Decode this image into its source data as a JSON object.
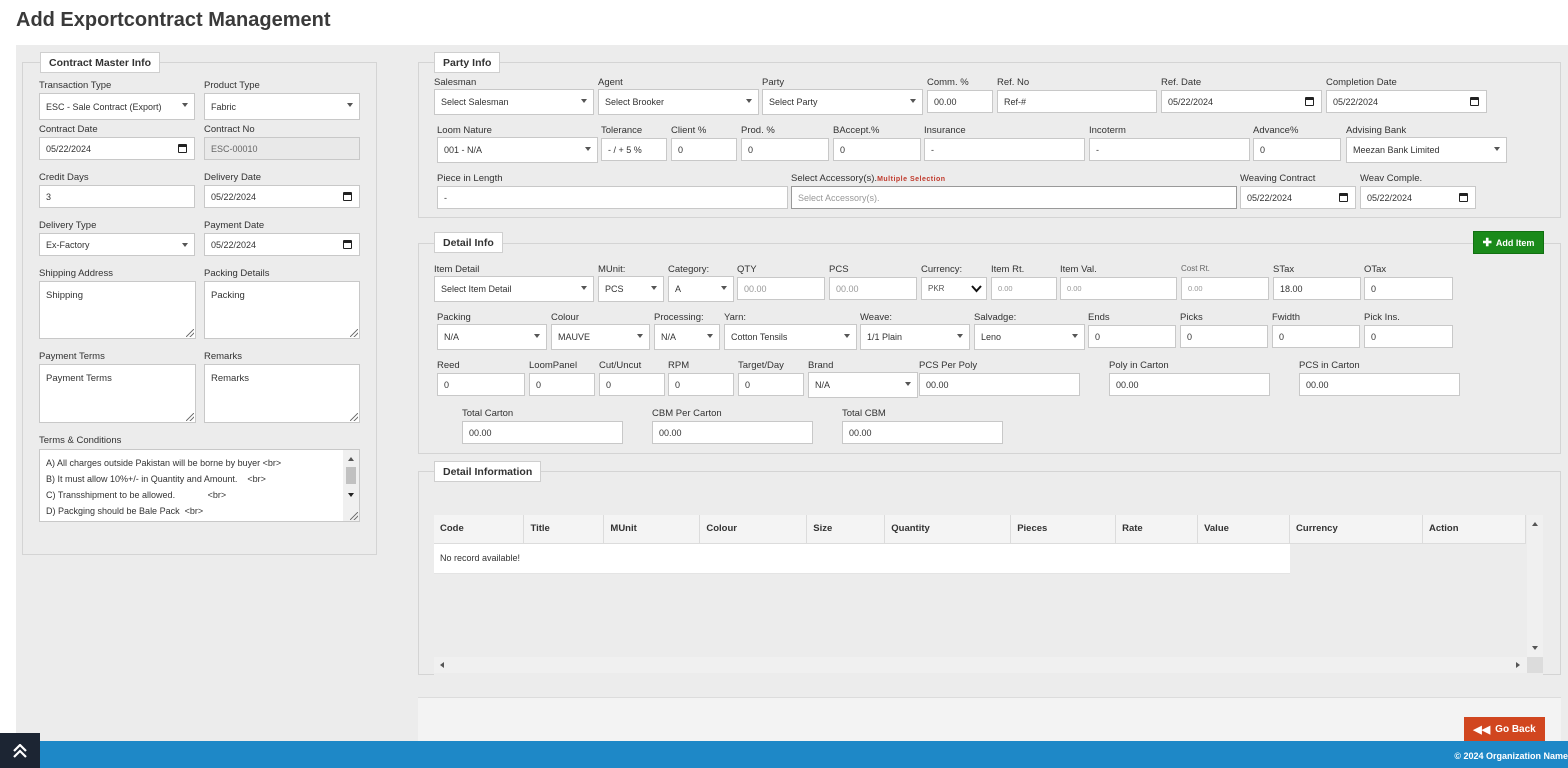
{
  "page": {
    "title": "Add Exportcontract Management"
  },
  "contract_master": {
    "legend": "Contract Master Info",
    "transaction_type": {
      "label": "Transaction Type",
      "value": "ESC - Sale Contract (Export)"
    },
    "product_type": {
      "label": "Product Type",
      "value": "Fabric"
    },
    "contract_date": {
      "label": "Contract Date",
      "value": "05/22/2024"
    },
    "contract_no": {
      "label": "Contract No",
      "value": "ESC-00010"
    },
    "credit_days": {
      "label": "Credit Days",
      "value": "3"
    },
    "delivery_date": {
      "label": "Delivery Date",
      "value": "05/22/2024"
    },
    "delivery_type": {
      "label": "Delivery Type",
      "value": "Ex-Factory"
    },
    "payment_date": {
      "label": "Payment Date",
      "value": "05/22/2024"
    },
    "shipping_address": {
      "label": "Shipping Address",
      "value": "Shipping"
    },
    "packing_details": {
      "label": "Packing Details",
      "value": "Packing"
    },
    "payment_terms": {
      "label": "Payment Terms",
      "value": "Payment Terms"
    },
    "remarks": {
      "label": "Remarks",
      "value": "Remarks"
    },
    "terms": {
      "label": "Terms & Conditions",
      "lines": [
        "A) All charges outside Pakistan will be borne by buyer <br>",
        "B) It must allow 10%+/- in Quantity and Amount.    <br>",
        "C) Transshipment to be allowed.             <br>",
        "D) Packging should be Bale Pack  <br>"
      ]
    }
  },
  "party": {
    "legend": "Party Info",
    "salesman": {
      "label": "Salesman",
      "value": "Select Salesman"
    },
    "agent": {
      "label": "Agent",
      "value": "Select Brooker"
    },
    "party": {
      "label": "Party",
      "value": "Select Party"
    },
    "comm": {
      "label": "Comm. %",
      "value": "00.00"
    },
    "ref_no": {
      "label": "Ref. No",
      "value": "Ref-#"
    },
    "ref_date": {
      "label": "Ref. Date",
      "value": "05/22/2024"
    },
    "completion_date": {
      "label": "Completion Date",
      "value": "05/22/2024"
    },
    "loom_nature": {
      "label": "Loom Nature",
      "value": "001 - N/A"
    },
    "tolerance": {
      "label": "Tolerance",
      "value": "- / + 5 %"
    },
    "client_pct": {
      "label": "Client %",
      "value": "0"
    },
    "prod_pct": {
      "label": "Prod. %",
      "value": "0"
    },
    "baccept": {
      "label": "BAccept.%",
      "value": "0"
    },
    "insurance": {
      "label": "Insurance",
      "value": "-"
    },
    "incoterm": {
      "label": "Incoterm",
      "value": "-"
    },
    "advance": {
      "label": "Advance%",
      "value": "0"
    },
    "advising_bank": {
      "label": "Advising Bank",
      "value": "Meezan Bank Limited"
    },
    "piece_length": {
      "label": "Piece in Length",
      "value": "-"
    },
    "accessories": {
      "label": "Select Accessory(s).",
      "note": "Multiple Selection",
      "placeholder": "Select Accessory(s)."
    },
    "weaving_contract": {
      "label": "Weaving Contract",
      "value": "05/22/2024"
    },
    "weav_comple": {
      "label": "Weav Comple.",
      "value": "05/22/2024"
    }
  },
  "detail": {
    "legend": "Detail Info",
    "add_item": "Add Item",
    "item_detail": {
      "label": "Item Detail",
      "value": "Select Item Detail"
    },
    "munit": {
      "label": "MUnit:",
      "value": "PCS"
    },
    "category": {
      "label": "Category:",
      "value": "A"
    },
    "qty": {
      "label": "QTY",
      "value": "00.00"
    },
    "pcs": {
      "label": "PCS",
      "value": "00.00"
    },
    "currency": {
      "label": "Currency:",
      "value": "PKR"
    },
    "item_rt": {
      "label": "Item Rt.",
      "value": "0.00"
    },
    "item_val": {
      "label": "Item Val.",
      "value": "0.00"
    },
    "cost_rt": {
      "label": "Cost Rt.",
      "value": "0.00"
    },
    "stax": {
      "label": "STax",
      "value": "18.00"
    },
    "otax": {
      "label": "OTax",
      "value": "0"
    },
    "packing": {
      "label": "Packing",
      "value": "N/A"
    },
    "colour": {
      "label": "Colour",
      "value": "MAUVE"
    },
    "processing": {
      "label": "Processing:",
      "value": "N/A"
    },
    "yarn": {
      "label": "Yarn:",
      "value": "Cotton Tensils"
    },
    "weave": {
      "label": "Weave:",
      "value": "1/1 Plain"
    },
    "salvadge": {
      "label": "Salvadge:",
      "value": "Leno"
    },
    "ends": {
      "label": "Ends",
      "value": "0"
    },
    "picks": {
      "label": "Picks",
      "value": "0"
    },
    "fwidth": {
      "label": "Fwidth",
      "value": "0"
    },
    "pick_ins": {
      "label": "Pick Ins.",
      "value": "0"
    },
    "reed": {
      "label": "Reed",
      "value": "0"
    },
    "loompanel": {
      "label": "LoomPanel",
      "value": "0"
    },
    "cutuncut": {
      "label": "Cut/Uncut",
      "value": "0"
    },
    "rpm": {
      "label": "RPM",
      "value": "0"
    },
    "target_day": {
      "label": "Target/Day",
      "value": "0"
    },
    "brand": {
      "label": "Brand",
      "value": "N/A"
    },
    "pcs_per_poly": {
      "label": "PCS Per Poly",
      "value": "00.00"
    },
    "poly_in_carton": {
      "label": "Poly in Carton",
      "value": "00.00"
    },
    "pcs_in_carton": {
      "label": "PCS in Carton",
      "value": "00.00"
    },
    "total_carton": {
      "label": "Total Carton",
      "value": "00.00"
    },
    "cbm_per_carton": {
      "label": "CBM Per Carton",
      "value": "00.00"
    },
    "total_cbm": {
      "label": "Total CBM",
      "value": "00.00"
    }
  },
  "detail_information": {
    "legend": "Detail Information",
    "columns": [
      "Code",
      "Title",
      "MUnit",
      "Colour",
      "Size",
      "Quantity",
      "Pieces",
      "Rate",
      "Value",
      "Currency",
      "Action"
    ],
    "empty": "No record available!"
  },
  "actions": {
    "go_back": "Go Back"
  },
  "footer": {
    "copyright": "© 2024 Organization Name"
  },
  "colors": {
    "add_button": "#1a8a1a",
    "back_button": "#d1461f",
    "footer": "#1e88c7"
  }
}
